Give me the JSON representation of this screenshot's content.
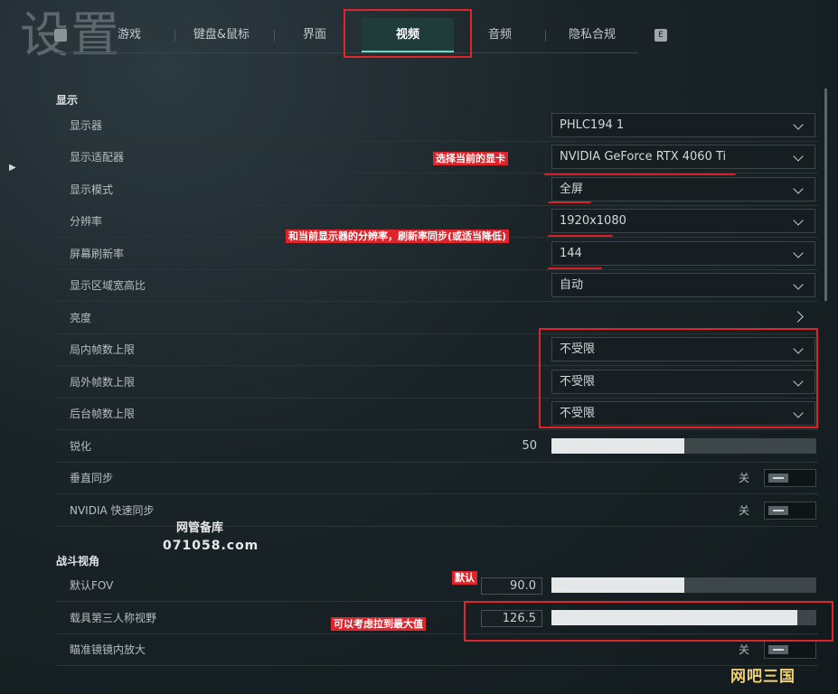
{
  "page_title": "设置",
  "tabs": [
    {
      "label": "游戏"
    },
    {
      "label": "键盘&鼠标"
    },
    {
      "label": "界面"
    },
    {
      "label": "视频",
      "active": true
    },
    {
      "label": "音频"
    },
    {
      "label": "隐私合规"
    }
  ],
  "tab_hotkey": "E",
  "sections": {
    "display": "显示",
    "combat_view": "战斗视角"
  },
  "display": {
    "monitor": {
      "label": "显示器",
      "value": "PHLC194 1"
    },
    "adapter": {
      "label": "显示适配器",
      "value": "NVIDIA GeForce RTX 4060 Ti"
    },
    "mode": {
      "label": "显示模式",
      "value": "全屏"
    },
    "resolution": {
      "label": "分辨率",
      "value": "1920x1080"
    },
    "refresh": {
      "label": "屏幕刷新率",
      "value": "144"
    },
    "aspect": {
      "label": "显示区域宽高比",
      "value": "自动"
    },
    "brightness": {
      "label": "亮度"
    },
    "fps_ingame": {
      "label": "局内帧数上限",
      "value": "不受限"
    },
    "fps_outgame": {
      "label": "局外帧数上限",
      "value": "不受限"
    },
    "fps_background": {
      "label": "后台帧数上限",
      "value": "不受限"
    },
    "sharpen": {
      "label": "锐化",
      "value": "50",
      "fill": 0.5
    },
    "vsync": {
      "label": "垂直同步",
      "state": "关"
    },
    "reflex": {
      "label": "NVIDIA 快速同步",
      "state": "关"
    }
  },
  "combat": {
    "fov": {
      "label": "默认FOV",
      "value": "90.0",
      "fill": 0.5
    },
    "vehicle_tp": {
      "label": "载具第三人称视野",
      "value": "126.5",
      "fill": 0.93
    },
    "scope_zoom": {
      "label": "瞄准镜镜内放大",
      "state": "关"
    }
  },
  "annotations": {
    "gpu_note": "选择当前的显卡",
    "res_note": "和当前显示器的分辨率，刷新率同步(或适当降低)",
    "default_note": "默认",
    "max_note": "可以考虑拉到最大值"
  },
  "watermarks": {
    "site_name": "网管备库",
    "site_url": "071058.com",
    "corner": "网吧三国"
  },
  "colors": {
    "accent": "#6fd9c4",
    "annotation_red": "#e0242b",
    "background": "#1a2428"
  }
}
